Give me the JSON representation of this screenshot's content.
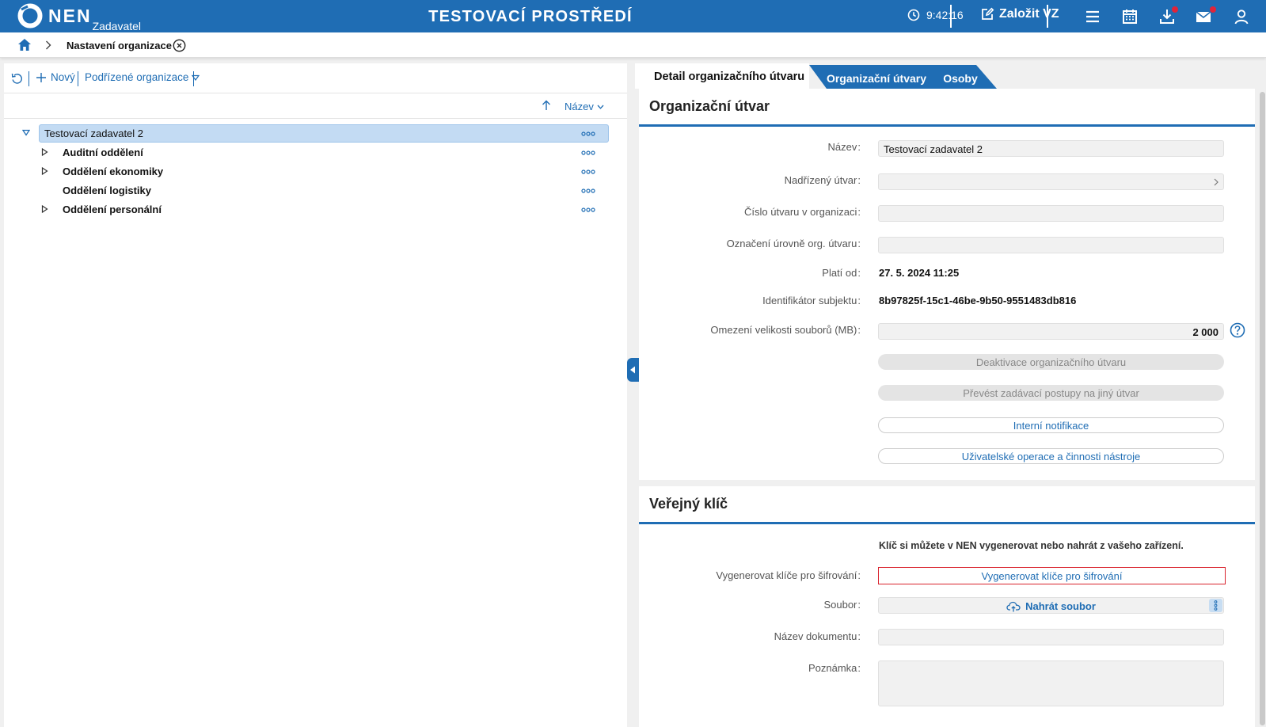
{
  "header": {
    "logo_name": "NEN",
    "logo_sub": "Zadavatel",
    "env_title": "TESTOVACÍ PROSTŘEDÍ",
    "clock": "9:42:16",
    "new_vz_label": "Založit VZ",
    "icons": [
      "clock-icon",
      "edit-icon",
      "menu-icon",
      "calendar-icon",
      "download-icon",
      "mail-icon",
      "user-icon"
    ],
    "accent_color": "#1f6db4",
    "notification_color": "#e0243a"
  },
  "breadcrumb": {
    "current": "Nastavení organizace"
  },
  "left": {
    "toolbar": {
      "new_label": "Nový",
      "sub_orgs_label": "Podřízené organizace"
    },
    "sort": {
      "label": "Název"
    },
    "tree": {
      "root": "Testovací zadavatel 2",
      "children": [
        {
          "label": "Auditní oddělení",
          "expandable": true
        },
        {
          "label": "Oddělení ekonomiky",
          "expandable": true
        },
        {
          "label": "Oddělení logistiky",
          "expandable": false
        },
        {
          "label": "Oddělení personální",
          "expandable": true
        }
      ]
    }
  },
  "tabs": [
    {
      "label": "Detail organizačního útvaru",
      "active": true
    },
    {
      "label": "Organizační útvary",
      "active": false
    },
    {
      "label": "Osoby",
      "active": false
    }
  ],
  "org_unit": {
    "title": "Organizační útvar",
    "name_label": "Název",
    "name_value": "Testovací zadavatel 2",
    "parent_label": "Nadřízený útvar",
    "parent_value": "",
    "number_label": "Číslo útvaru v organizaci",
    "number_value": "",
    "level_label": "Označení úrovně org. útvaru",
    "level_value": "",
    "valid_from_label": "Platí od",
    "valid_from_value": "27. 5. 2024 11:25",
    "subject_id_label": "Identifikátor subjektu",
    "subject_id_value": "8b97825f-15c1-46be-9b50-9551483db816",
    "size_limit_label": "Omezení velikosti souborů (MB)",
    "size_limit_value": "2 000",
    "deactivate_btn": "Deaktivace organizačního útvaru",
    "transfer_btn": "Převést zadávací postupy na jiný útvar",
    "notifications_btn": "Interní notifikace",
    "user_ops_btn": "Uživatelské operace a činnosti nástroje"
  },
  "public_key": {
    "title": "Veřejný klíč",
    "info": "Klíč si můžete v NEN vygenerovat nebo nahrát z vašeho zařízení.",
    "generate_label": "Vygenerovat klíče pro šifrování",
    "generate_btn": "Vygenerovat klíče pro šifrování",
    "file_label": "Soubor",
    "upload_btn": "Nahrát soubor",
    "doc_name_label": "Název dokumentu",
    "doc_name_value": "",
    "note_label": "Poznámka",
    "note_value": ""
  }
}
